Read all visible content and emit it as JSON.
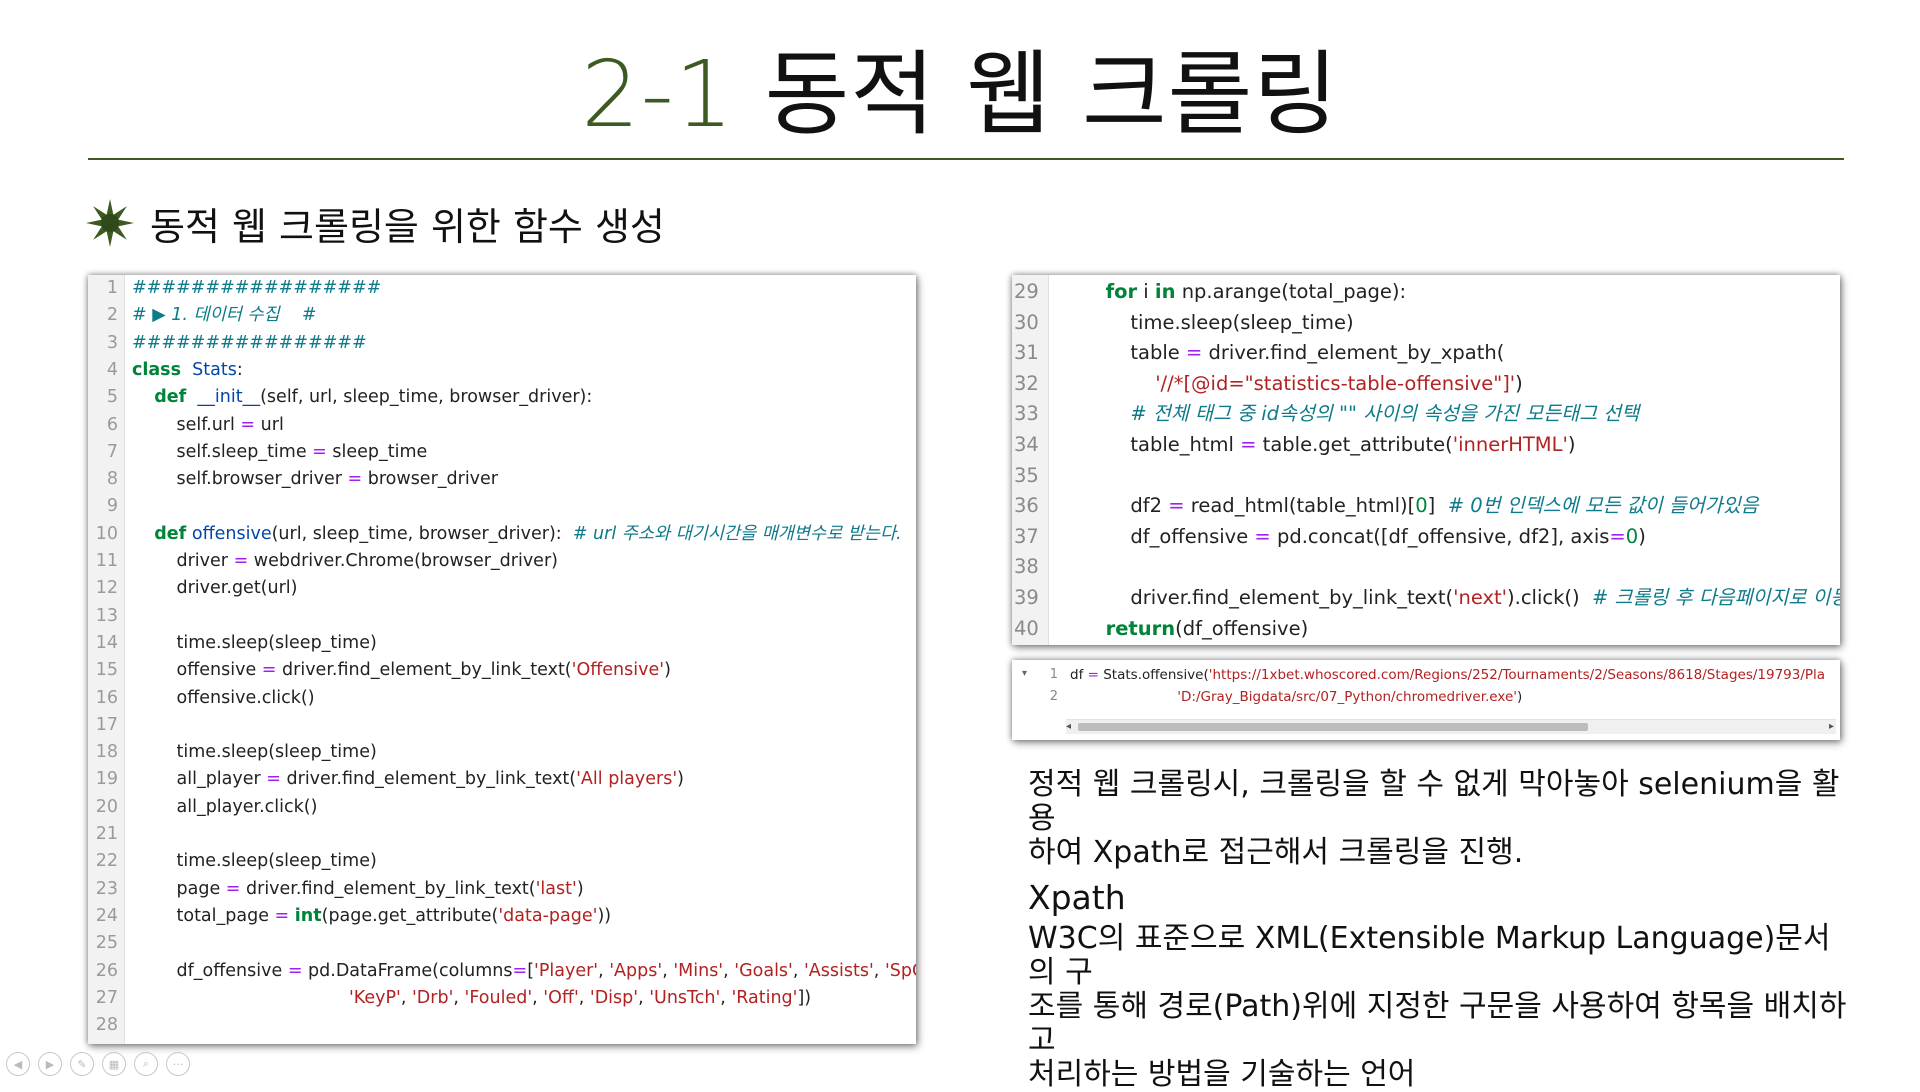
{
  "slide": {
    "title_number": "2-1",
    "title_text": "동적 웹 크롤링",
    "subheading": "동적 웹 크롤링을 위한 함수 생성"
  },
  "left_code": [
    {
      "n": "1",
      "segs": [
        [
          "cm",
          "#################"
        ]
      ]
    },
    {
      "n": "2",
      "segs": [
        [
          "cm",
          "# ▶ 1. 데이터 수집    #"
        ]
      ]
    },
    {
      "n": "3",
      "segs": [
        [
          "cm",
          "################"
        ]
      ]
    },
    {
      "n": "4",
      "segs": [
        [
          "kw",
          "class"
        ],
        [
          "",
          "  "
        ],
        [
          "cls",
          "Stats"
        ],
        [
          "",
          ":"
        ]
      ]
    },
    {
      "n": "5",
      "segs": [
        [
          "",
          "    "
        ],
        [
          "kw",
          "def"
        ],
        [
          "",
          "  "
        ],
        [
          "fn",
          "__init__"
        ],
        [
          "",
          "(self, url, sleep_time, browser_driver):"
        ]
      ]
    },
    {
      "n": "6",
      "segs": [
        [
          "",
          "        self.url "
        ],
        [
          "op",
          "="
        ],
        [
          "",
          " url"
        ]
      ]
    },
    {
      "n": "7",
      "segs": [
        [
          "",
          "        self.sleep_time "
        ],
        [
          "op",
          "="
        ],
        [
          "",
          " sleep_time"
        ]
      ]
    },
    {
      "n": "8",
      "segs": [
        [
          "",
          "        self.browser_driver "
        ],
        [
          "op",
          "="
        ],
        [
          "",
          " browser_driver"
        ]
      ]
    },
    {
      "n": "9",
      "segs": []
    },
    {
      "n": "10",
      "segs": [
        [
          "",
          "    "
        ],
        [
          "kw",
          "def"
        ],
        [
          "",
          " "
        ],
        [
          "fn",
          "offensive"
        ],
        [
          "",
          "(url, sleep_time, browser_driver):  "
        ],
        [
          "cm",
          "# url 주소와 대기시간을 매개변수로 받는다."
        ]
      ]
    },
    {
      "n": "11",
      "segs": [
        [
          "",
          "        driver "
        ],
        [
          "op",
          "="
        ],
        [
          "",
          " webdriver.Chrome(browser_driver)"
        ]
      ]
    },
    {
      "n": "12",
      "segs": [
        [
          "",
          "        driver.get(url)"
        ]
      ]
    },
    {
      "n": "13",
      "segs": []
    },
    {
      "n": "14",
      "segs": [
        [
          "",
          "        time.sleep(sleep_time)"
        ]
      ]
    },
    {
      "n": "15",
      "segs": [
        [
          "",
          "        offensive "
        ],
        [
          "op",
          "="
        ],
        [
          "",
          " driver.find_element_by_link_text("
        ],
        [
          "str",
          "'Offensive'"
        ],
        [
          "",
          ")"
        ]
      ]
    },
    {
      "n": "16",
      "segs": [
        [
          "",
          "        offensive.click()"
        ]
      ]
    },
    {
      "n": "17",
      "segs": []
    },
    {
      "n": "18",
      "segs": [
        [
          "",
          "        time.sleep(sleep_time)"
        ]
      ]
    },
    {
      "n": "19",
      "segs": [
        [
          "",
          "        all_player "
        ],
        [
          "op",
          "="
        ],
        [
          "",
          " driver.find_element_by_link_text("
        ],
        [
          "str",
          "'All players'"
        ],
        [
          "",
          ")"
        ]
      ]
    },
    {
      "n": "20",
      "segs": [
        [
          "",
          "        all_player.click()"
        ]
      ]
    },
    {
      "n": "21",
      "segs": []
    },
    {
      "n": "22",
      "segs": [
        [
          "",
          "        time.sleep(sleep_time)"
        ]
      ]
    },
    {
      "n": "23",
      "segs": [
        [
          "",
          "        page "
        ],
        [
          "op",
          "="
        ],
        [
          "",
          " driver.find_element_by_link_text("
        ],
        [
          "str",
          "'last'"
        ],
        [
          "",
          ")"
        ]
      ]
    },
    {
      "n": "24",
      "segs": [
        [
          "",
          "        total_page "
        ],
        [
          "op",
          "="
        ],
        [
          "",
          " "
        ],
        [
          "kw",
          "int"
        ],
        [
          "",
          "(page.get_attribute("
        ],
        [
          "str",
          "'data-page'"
        ],
        [
          "",
          "))"
        ]
      ]
    },
    {
      "n": "25",
      "segs": []
    },
    {
      "n": "26",
      "segs": [
        [
          "",
          "        df_offensive "
        ],
        [
          "op",
          "="
        ],
        [
          "",
          " pd.DataFrame(columns"
        ],
        [
          "op",
          "="
        ],
        [
          "",
          "["
        ],
        [
          "str",
          "'Player'"
        ],
        [
          "",
          ", "
        ],
        [
          "str",
          "'Apps'"
        ],
        [
          "",
          ", "
        ],
        [
          "str",
          "'Mins'"
        ],
        [
          "",
          ", "
        ],
        [
          "str",
          "'Goals'"
        ],
        [
          "",
          ", "
        ],
        [
          "str",
          "'Assists'"
        ],
        [
          "",
          ", "
        ],
        [
          "str",
          "'SpG'"
        ],
        [
          "",
          ","
        ]
      ]
    },
    {
      "n": "27",
      "segs": [
        [
          "",
          "                                       "
        ],
        [
          "str",
          "'KeyP'"
        ],
        [
          "",
          ", "
        ],
        [
          "str",
          "'Drb'"
        ],
        [
          "",
          ", "
        ],
        [
          "str",
          "'Fouled'"
        ],
        [
          "",
          ", "
        ],
        [
          "str",
          "'Off'"
        ],
        [
          "",
          ", "
        ],
        [
          "str",
          "'Disp'"
        ],
        [
          "",
          ", "
        ],
        [
          "str",
          "'UnsTch'"
        ],
        [
          "",
          ", "
        ],
        [
          "str",
          "'Rating'"
        ],
        [
          "",
          "])"
        ]
      ]
    },
    {
      "n": "28",
      "segs": []
    }
  ],
  "right_code": [
    {
      "n": "29",
      "segs": [
        [
          "",
          "        "
        ],
        [
          "kw",
          "for"
        ],
        [
          "",
          " i "
        ],
        [
          "kw",
          "in"
        ],
        [
          "",
          " np.arange(total_page):"
        ]
      ]
    },
    {
      "n": "30",
      "segs": [
        [
          "",
          "            time.sleep(sleep_time)"
        ]
      ]
    },
    {
      "n": "31",
      "segs": [
        [
          "",
          "            table "
        ],
        [
          "op",
          "="
        ],
        [
          "",
          " driver.find_element_by_xpath("
        ]
      ]
    },
    {
      "n": "32",
      "segs": [
        [
          "",
          "                "
        ],
        [
          "str",
          "'//*[@id=\"statistics-table-offensive\"]'"
        ],
        [
          "",
          ")"
        ]
      ]
    },
    {
      "n": "33",
      "segs": [
        [
          "",
          "            "
        ],
        [
          "cm",
          "# 전체 태그 중 id속성의 \"\" 사이의 속성을 가진 모든태그 선택"
        ]
      ]
    },
    {
      "n": "34",
      "segs": [
        [
          "",
          "            table_html "
        ],
        [
          "op",
          "="
        ],
        [
          "",
          " table.get_attribute("
        ],
        [
          "str",
          "'innerHTML'"
        ],
        [
          "",
          ")"
        ]
      ]
    },
    {
      "n": "35",
      "segs": []
    },
    {
      "n": "36",
      "segs": [
        [
          "",
          "            df2 "
        ],
        [
          "op",
          "="
        ],
        [
          "",
          " read_html(table_html)["
        ],
        [
          "num",
          "0"
        ],
        [
          "",
          "]  "
        ],
        [
          "cm",
          "# 0번 인덱스에 모든 값이 들어가있음"
        ]
      ]
    },
    {
      "n": "37",
      "segs": [
        [
          "",
          "            df_offensive "
        ],
        [
          "op",
          "="
        ],
        [
          "",
          " pd.concat([df_offensive, df2], axis"
        ],
        [
          "op",
          "="
        ],
        [
          "num",
          "0"
        ],
        [
          "",
          ")"
        ]
      ]
    },
    {
      "n": "38",
      "segs": []
    },
    {
      "n": "39",
      "segs": [
        [
          "",
          "            driver.find_element_by_link_text("
        ],
        [
          "str",
          "'next'"
        ],
        [
          "",
          ").click()  "
        ],
        [
          "cm",
          "# 크롤링 후 다음페이지로 이동"
        ]
      ]
    },
    {
      "n": "40",
      "segs": [
        [
          "",
          "        "
        ],
        [
          "kw",
          "return"
        ],
        [
          "",
          "(df_offensive)"
        ]
      ]
    }
  ],
  "console": {
    "fold_icon": "▾",
    "lines": [
      {
        "n": "1",
        "segs": [
          [
            "",
            "df "
          ],
          [
            "op",
            "="
          ],
          [
            "",
            " Stats.offensive("
          ],
          [
            "str",
            "'https://1xbet.whoscored.com/Regions/252/Tournaments/2/Seasons/8618/Stages/19793/Pla"
          ]
        ]
      },
      {
        "n": "2",
        "segs": [
          [
            "",
            "                         "
          ],
          [
            "str",
            "'D:/Gray_Bigdata/src/07_Python/chromedriver.exe'"
          ],
          [
            "",
            ")"
          ]
        ]
      }
    ],
    "scroll_left": "◂",
    "scroll_right": "▸"
  },
  "description": {
    "line1": "정적 웹 크롤링시, 크롤링을 할 수 없게 막아놓아 selenium을 활용",
    "line2": "하여 Xpath로 접근해서 크롤링을 진행.",
    "xpath_title": "Xpath",
    "xpath_line1": " W3C의 표준으로 XML(Extensible Markup Language)문서의 구",
    "xpath_line2": "조를 통해 경로(Path)위에 지정한 구문을 사용하여 항목을 배치하고",
    "xpath_line3": "처리하는 방법을 기술하는 언어"
  },
  "colors": {
    "accent_green": "#3d5a23",
    "keyword": "#00843a",
    "string": "#b22222",
    "comment": "#0e7a8a",
    "operator": "#a020f0"
  },
  "toolbar": {
    "icons": [
      "prev-icon",
      "next-icon",
      "pen-icon",
      "slides-icon",
      "zoom-icon",
      "more-icon"
    ],
    "glyphs": [
      "◀",
      "▶",
      "✎",
      "▦",
      "⌕",
      "···"
    ]
  }
}
